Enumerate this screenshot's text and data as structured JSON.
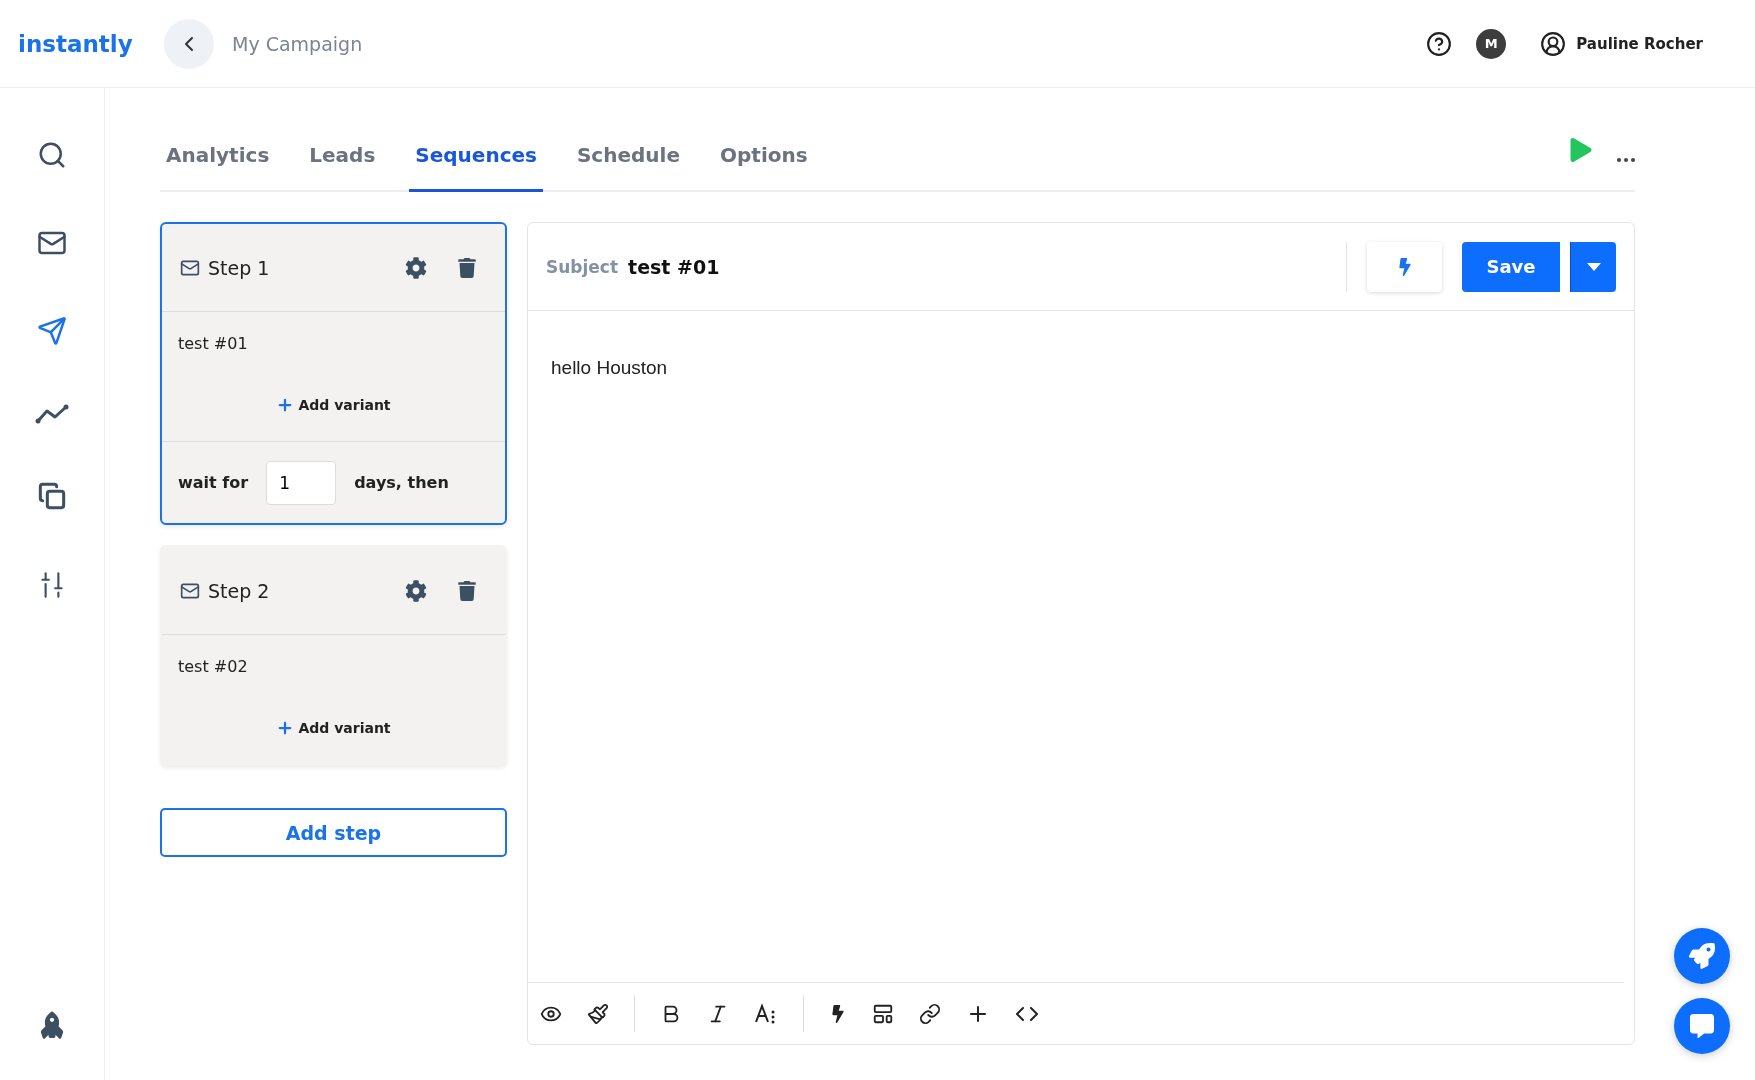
{
  "brand": "instantly",
  "header": {
    "campaign_title": "My Campaign",
    "avatar_initial": "M",
    "user_name": "Pauline Rocher"
  },
  "sidebar": {
    "items": [
      {
        "kind": "search",
        "selected": false
      },
      {
        "kind": "mail",
        "selected": false
      },
      {
        "kind": "send",
        "selected": true
      },
      {
        "kind": "chart",
        "selected": false
      },
      {
        "kind": "copy",
        "selected": false
      },
      {
        "kind": "sliders",
        "selected": false
      }
    ]
  },
  "tabs": [
    {
      "label": "Analytics",
      "selected": false
    },
    {
      "label": "Leads",
      "selected": false
    },
    {
      "label": "Sequences",
      "selected": true
    },
    {
      "label": "Schedule",
      "selected": false
    },
    {
      "label": "Options",
      "selected": false
    }
  ],
  "steps": [
    {
      "title": "Step 1",
      "selected": true,
      "variant": "test #01",
      "add_variant": "Add variant",
      "wait": {
        "label": "wait for",
        "value": "1",
        "suffix": "days, then"
      }
    },
    {
      "title": "Step 2",
      "selected": false,
      "variant": "test #02",
      "add_variant": "Add variant"
    }
  ],
  "add_step": "Add step",
  "editor": {
    "subject_label": "Subject",
    "subject": "test #01",
    "save": "Save",
    "body": "hello Houston"
  }
}
